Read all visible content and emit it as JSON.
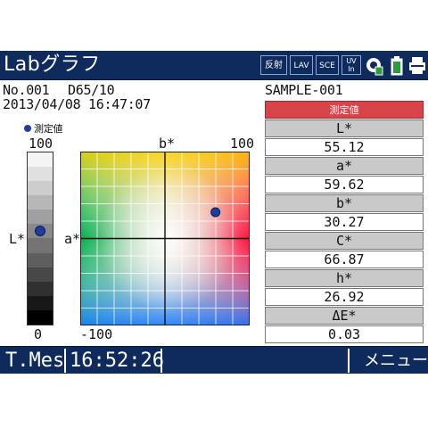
{
  "header": {
    "title": "Labグラフ",
    "buttons": [
      "反射",
      "LAV",
      "SCE"
    ],
    "uv_top": "UV",
    "uv_bottom": "In",
    "icons": [
      "sd-card-icon",
      "battery-icon",
      "printer-icon"
    ]
  },
  "measurement": {
    "number": "No.001",
    "illuminant": "D65/10",
    "datetime": "2013/04/08 16:47:07",
    "sample_name": "SAMPLE-001"
  },
  "legend": {
    "marker_label": "測定値"
  },
  "lightness_scale": {
    "top_label": "100",
    "bottom_label": "0",
    "axis_label": "L*",
    "current_L": 55.12,
    "gray_steps": [
      "#f4f4f4",
      "#e0e0e0",
      "#cdcdcd",
      "#b7b7b7",
      "#a0a0a0",
      "#8a8a8a",
      "#747474",
      "#5e5e5e",
      "#484848",
      "#303030",
      "#181818",
      "#000000"
    ]
  },
  "ab_chart": {
    "b_axis_label": "b*",
    "a_axis_label": "a*",
    "top_right_label": "100",
    "bottom_left_label": "-100",
    "range": [
      -100,
      100
    ],
    "point": {
      "a": 59.62,
      "b": 30.27
    },
    "marker_color": "#1f3d9e"
  },
  "results": {
    "header": "測定値",
    "rows": [
      {
        "label": "L*",
        "value": "55.12"
      },
      {
        "label": "a*",
        "value": "59.62"
      },
      {
        "label": "b*",
        "value": "30.27"
      },
      {
        "label": "C*",
        "value": "66.87"
      },
      {
        "label": "h*",
        "value": "26.92"
      },
      {
        "label": "ΔE*",
        "value": "0.03"
      }
    ]
  },
  "footer": {
    "mode": "T.Mes",
    "time": "16:52:26",
    "menu": "メニュー"
  },
  "colors": {
    "bar": "#0f2a5c",
    "results_header": "#d8444a",
    "label_row": "#c9c9c9"
  }
}
